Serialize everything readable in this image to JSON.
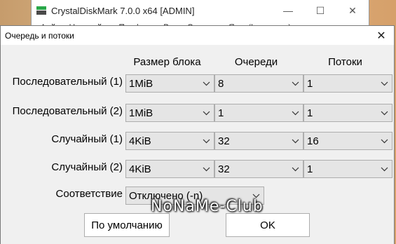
{
  "parent": {
    "title": "CrystalDiskMark 7.0.0 x64 [ADMIN]",
    "menu": [
      "Файл",
      "Настройки",
      "Профиль",
      "Вид",
      "Справка",
      "Язык(Language)"
    ],
    "minimize_glyph": "—",
    "maximize_glyph": "☐",
    "close_glyph": "✕"
  },
  "dialog": {
    "title": "Очередь и потоки",
    "close_glyph": "✕",
    "headers": {
      "block_size": "Размер блока",
      "queues": "Очереди",
      "threads": "Потоки"
    },
    "rows": [
      {
        "label": "Последовательный (1)",
        "block_size": "1MiB",
        "queues": "8",
        "threads": "1"
      },
      {
        "label": "Последовательный (2)",
        "block_size": "1MiB",
        "queues": "1",
        "threads": "1"
      },
      {
        "label": "Случайный (1)",
        "block_size": "4KiB",
        "queues": "32",
        "threads": "16"
      },
      {
        "label": "Случайный (2)",
        "block_size": "4KiB",
        "queues": "32",
        "threads": "1"
      }
    ],
    "compat": {
      "label": "Соответствие",
      "value": "Отключено (-n)"
    },
    "buttons": {
      "default": "По умолчанию",
      "ok": "OK"
    }
  },
  "watermark": "NoNaMe-Club"
}
